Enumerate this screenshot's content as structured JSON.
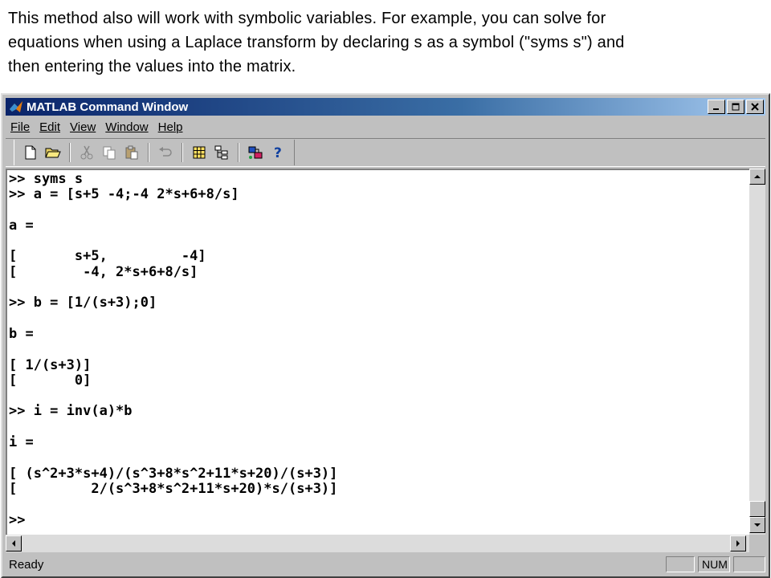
{
  "slide": {
    "text": "This method also will work with symbolic variables.  For example, you can solve for\nequations when using a Laplace transform by declaring s as a symbol (\"syms s\") and\nthen entering the values into the matrix."
  },
  "window": {
    "title": "MATLAB Command Window"
  },
  "menu": {
    "items": [
      "File",
      "Edit",
      "View",
      "Window",
      "Help"
    ]
  },
  "console": {
    "lines": [
      ">> syms s",
      ">> a = [s+5 -4;-4 2*s+6+8/s]",
      "",
      "a =",
      "",
      "[       s+5,         -4]",
      "[        -4, 2*s+6+8/s]",
      "",
      ">> b = [1/(s+3);0]",
      "",
      "b =",
      "",
      "[ 1/(s+3)]",
      "[       0]",
      "",
      ">> i = inv(a)*b",
      "",
      "i =",
      "",
      "[ (s^2+3*s+4)/(s^3+8*s^2+11*s+20)/(s+3)]",
      "[         2/(s^3+8*s^2+11*s+20)*s/(s+3)]",
      "",
      ">>"
    ]
  },
  "status": {
    "ready": "Ready",
    "num": "NUM"
  },
  "colors": {
    "title_start": "#0a246a",
    "title_end": "#a6caf0",
    "chrome": "#c0c0c0"
  }
}
